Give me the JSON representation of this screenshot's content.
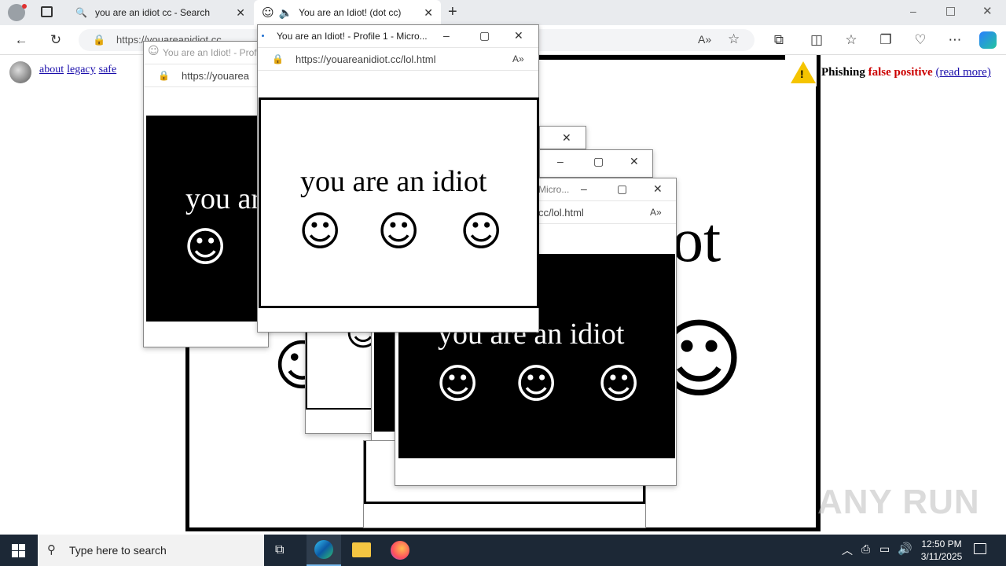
{
  "browser": {
    "tabs": [
      {
        "title": "you are an idiot cc - Search"
      },
      {
        "title": "You are an Idiot! (dot cc)"
      }
    ],
    "address_url": "https://youareanidiot.cc"
  },
  "page": {
    "nav_links": [
      "about",
      "legacy",
      "safe"
    ],
    "phishing": {
      "label": "Phishing",
      "status": "false positive",
      "link": "(read more)"
    },
    "big_text_tail": "ot"
  },
  "popups": {
    "title_back": "You are an Idiot! - Profi",
    "title_front": "You are an Idiot! - Profile 1 - Micro...",
    "title_mid": "Micro...",
    "url_front": "https://youareanidiot.cc/lol.html",
    "url_back": "https://youarea",
    "url_mid": "cc/lol.html",
    "text_front": "you are an idiot",
    "text_back": "you ar",
    "text_mid": "you are an idiot"
  },
  "taskbar": {
    "search_placeholder": "Type here to search",
    "time": "12:50 PM",
    "date": "3/11/2025"
  },
  "watermark": "ANY RUN",
  "colors": {
    "accent": "#1c2836",
    "warning_red": "#cc0000",
    "link": "#1a0dab"
  }
}
